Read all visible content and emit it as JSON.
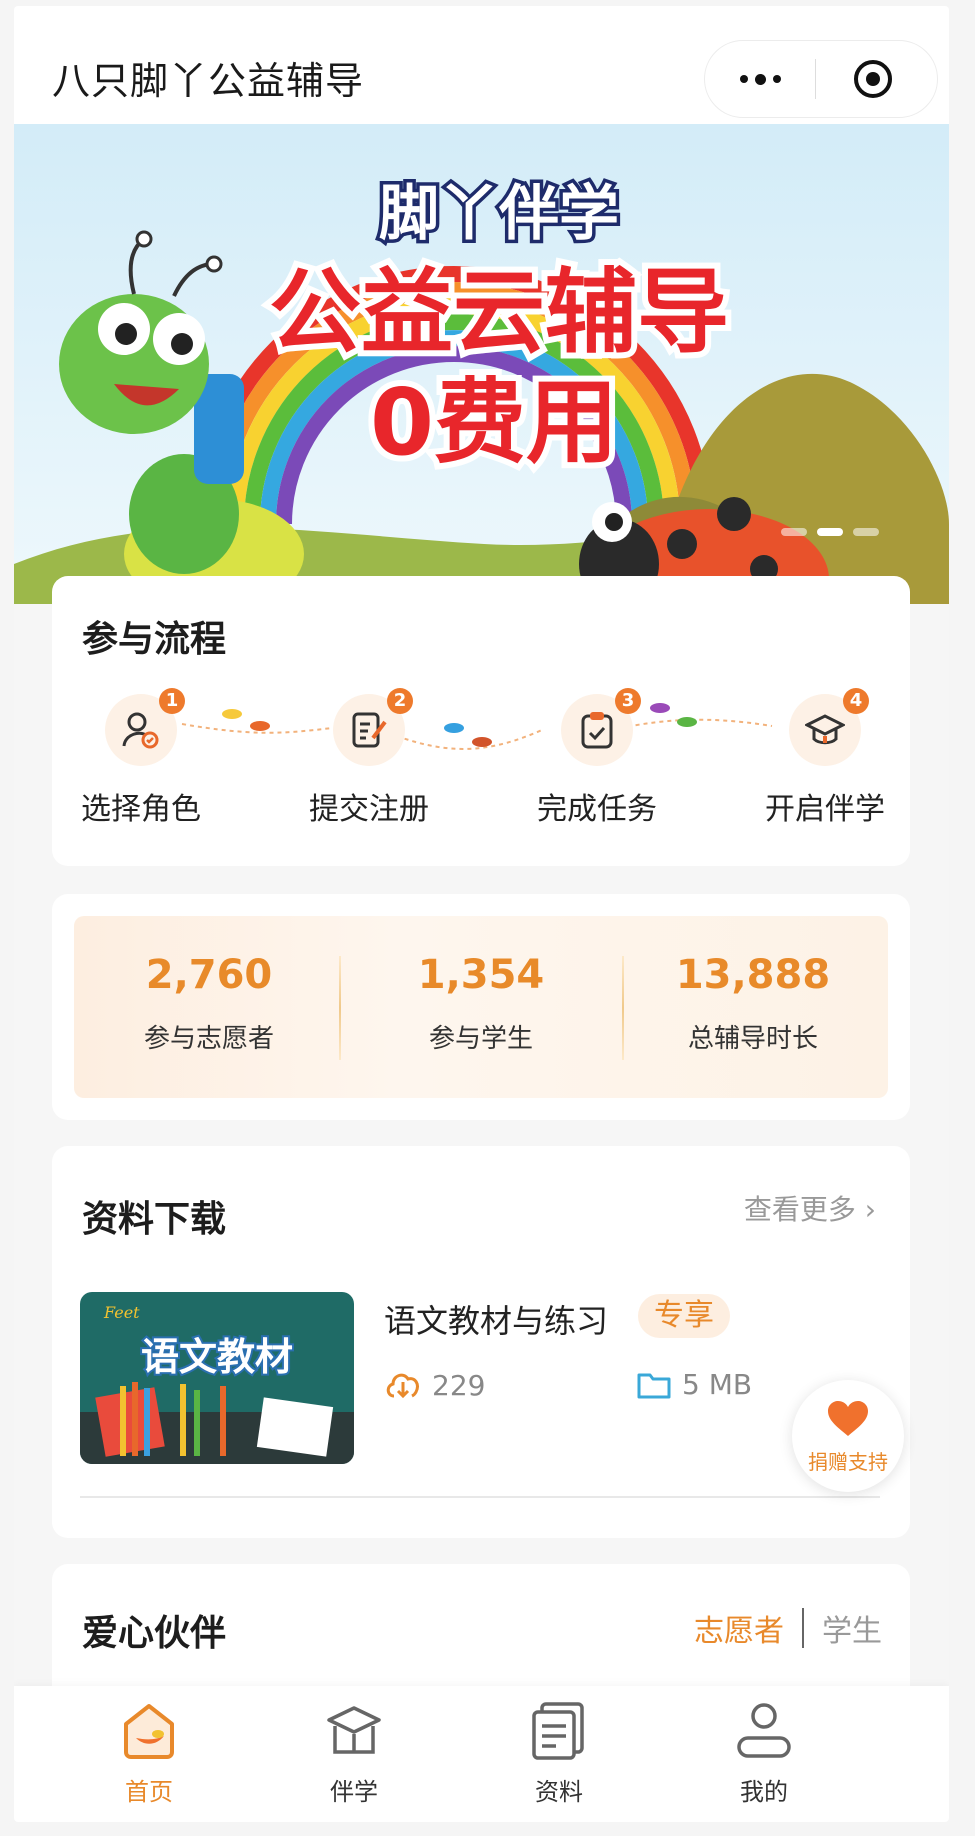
{
  "header": {
    "app_title": "八只脚丫公益辅导"
  },
  "banner": {
    "line1": "脚丫伴学",
    "line2": "公益云辅导",
    "line3": "0费用"
  },
  "process": {
    "title": "参与流程",
    "steps": [
      {
        "num": "1",
        "label": "选择角色",
        "icon": "user-check-icon"
      },
      {
        "num": "2",
        "label": "提交注册",
        "icon": "edit-document-icon"
      },
      {
        "num": "3",
        "label": "完成任务",
        "icon": "clipboard-check-icon"
      },
      {
        "num": "4",
        "label": "开启伴学",
        "icon": "graduation-cap-icon"
      }
    ]
  },
  "stats": [
    {
      "value": "2,760",
      "label": "参与志愿者"
    },
    {
      "value": "1,354",
      "label": "参与学生"
    },
    {
      "value": "13,888",
      "label": "总辅导时长"
    }
  ],
  "downloads": {
    "title": "资料下载",
    "more": "查看更多",
    "item": {
      "thumb_text": "语文教材",
      "thumb_brand": "Feet",
      "title": "语文教材与练习",
      "badge": "专享",
      "downloads": "229",
      "size": "5 MB"
    },
    "donate": "捐赠支持"
  },
  "partners": {
    "title": "爱心伙伴",
    "tab_active": "志愿者",
    "tab_inactive": "学生"
  },
  "tabbar": [
    {
      "label": "首页",
      "icon": "home-icon",
      "active": true
    },
    {
      "label": "伴学",
      "icon": "study-icon",
      "active": false
    },
    {
      "label": "资料",
      "icon": "document-icon",
      "active": false
    },
    {
      "label": "我的",
      "icon": "profile-icon",
      "active": false
    }
  ],
  "colors": {
    "accent": "#e8892b",
    "badge_bg": "#fdeee0",
    "step_num": "#ee7a2c"
  }
}
